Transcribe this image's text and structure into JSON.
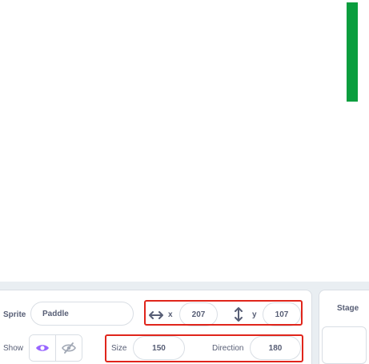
{
  "sprite_info": {
    "sprite_label": "Sprite",
    "sprite_name": "Paddle",
    "x_label": "x",
    "x_value": "207",
    "y_label": "y",
    "y_value": "107",
    "show_label": "Show",
    "size_label": "Size",
    "size_value": "150",
    "direction_label": "Direction",
    "direction_value": "180"
  },
  "stage_pane": {
    "title": "Stage"
  },
  "icons": {
    "x_icon": "horizontal-arrows-icon",
    "y_icon": "vertical-arrows-icon",
    "show_icon": "eye-icon",
    "hide_icon": "eye-slash-icon"
  },
  "colors": {
    "paddle": "#0a9e3e",
    "highlight": "#e0251b",
    "show_active": "#9966ff",
    "text": "#575e75"
  }
}
